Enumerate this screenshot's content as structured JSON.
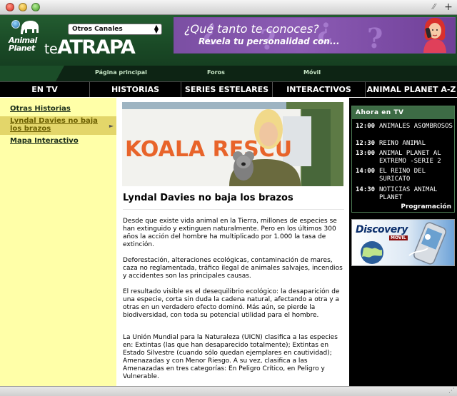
{
  "browser": {
    "plus_label": "+"
  },
  "header": {
    "logo_text": "Animal Planet",
    "te": "te",
    "atrapa": "ATRAPA",
    "select_value": "Otros Canales",
    "banner_line1": "¿Qué tanto te conoces?",
    "banner_line2": "Revela tu personalidad con..."
  },
  "subnav": [
    {
      "label": "Página principal"
    },
    {
      "label": "Foros"
    },
    {
      "label": "Móvil"
    }
  ],
  "mainnav": [
    {
      "label": "EN TV"
    },
    {
      "label": "HISTORIAS"
    },
    {
      "label": "SERIES ESTELARES"
    },
    {
      "label": "INTERACTIVOS"
    },
    {
      "label": "ANIMAL PLANET A-Z"
    }
  ],
  "sidebar": {
    "items": [
      {
        "label": "Otras Historias"
      },
      {
        "label": "Lyndal Davies no baja los brazos"
      },
      {
        "label": "Mapa Interactivo"
      }
    ],
    "arrow": "►"
  },
  "article": {
    "photo_sign": "KOALA RESCU",
    "title": "Lyndal Davies no baja los brazos",
    "paragraphs": [
      "Desde que existe vida animal en la Tierra, millones de especies se han extinguido y extinguen naturalmente. Pero en los últimos 300 años la acción del hombre ha multiplicado por 1.000 la tasa de extinción.",
      "Deforestación, alteraciones ecológicas, contaminación de mares, caza no reglamentada, tráfico ilegal de animales salvajes, incendios y accidentes son las principales causas.",
      "El resultado visible es el desequilibrio ecológico: la desaparición de una especie, corta sin duda la cadena natural, afectando a otra y a otras en un verdadero efecto dominó. Más aún, se pierde la biodiversidad, con toda su potencial utilidad para el hombre.",
      "La Unión Mundial para la Naturaleza (UICN) clasifica a las especies en: Extintas (las que han desaparecido totalmente); Extintas en Estado Silvestre (cuando sólo quedan ejemplares en cautividad); Amenazadas y con Menor Riesgo. A su vez, clasifica a las Amenazadas en tres categorías: En Peligro Crítico, en Peligro y Vulnerable."
    ]
  },
  "ahora": {
    "heading": "Ahora en TV",
    "schedule": [
      {
        "time": "12:00",
        "show": "ANIMALES ASOMBROSOS"
      },
      {
        "time": "12:30",
        "show": "REINO ANIMAL"
      },
      {
        "time": "13:00",
        "show": "ANIMAL PLANET AL EXTREMO -SERIE 2"
      },
      {
        "time": "14:00",
        "show": "EL REINO DEL SURICATO"
      },
      {
        "time": "14:30",
        "show": "NOTICIAS ANIMAL PLANET"
      }
    ],
    "programacion": "Programación"
  },
  "discovery_ad": {
    "brand": "Discovery",
    "tag": "MOVIL"
  },
  "colors": {
    "header_green": "#1b4d28",
    "sidebar_yellow": "#ffffa8",
    "selected_yellow": "#e3d66a",
    "nav_black": "#000000",
    "banner_purple": "#7b4fa3"
  }
}
